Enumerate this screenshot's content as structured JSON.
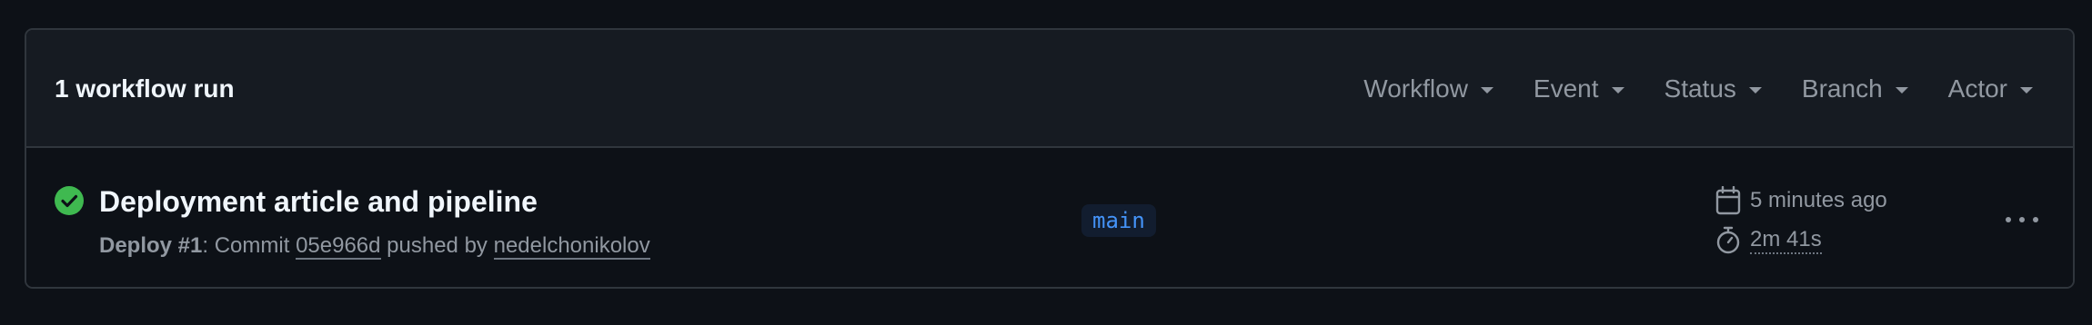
{
  "header": {
    "run_count": "1 workflow run",
    "filters": [
      "Workflow",
      "Event",
      "Status",
      "Branch",
      "Actor"
    ]
  },
  "run": {
    "status": "success",
    "status_color": "#3fb950",
    "title": "Deployment article and pipeline",
    "workflow_label": "Deploy #1",
    "meta_colon": ": Commit ",
    "commit_sha": "05e966d",
    "pushed_by_text": " pushed by ",
    "actor": "nedelchonikolov",
    "branch": "main",
    "time_ago": "5 minutes ago",
    "duration": "2m 41s"
  },
  "colors": {
    "background": "#0d1117",
    "header_bg": "#161b22",
    "border": "#30363d",
    "muted_text": "#9198a1",
    "branch_text": "#4493f8",
    "branch_bg": "#121d2f"
  },
  "icons": {
    "status": "check-circle-fill-icon",
    "time": "calendar-icon",
    "duration": "stopwatch-icon",
    "menu": "kebab-horizontal-icon"
  }
}
